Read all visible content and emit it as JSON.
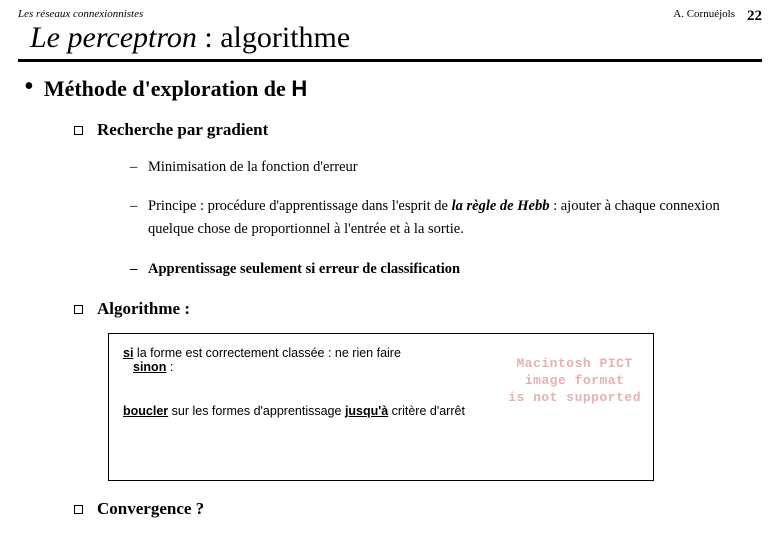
{
  "header": {
    "subtitle": "Les réseaux connexionnistes",
    "author": "A. Cornuéjols",
    "page": "22"
  },
  "title": {
    "part1": "Le perceptron",
    "part2": " : algorithme"
  },
  "lvl1": {
    "prefix": "Méthode d'exploration de ",
    "h": "H"
  },
  "sec1": {
    "label": "Recherche par gradient"
  },
  "b1": "Minimisation de la fonction d'erreur",
  "b2": {
    "pre": "Principe : procédure d'apprentissage dans l'esprit de ",
    "em": "la règle de Hebb",
    "post": " : ajouter à chaque connexion quelque chose de proportionnel à l'entrée et à la sortie."
  },
  "b3": "Apprentissage seulement si erreur de classification",
  "sec2": {
    "label": "Algorithme :"
  },
  "algo": {
    "l1_u": "si",
    "l1_rest": " la forme est correctement classée : ne rien faire",
    "l2": "sinon",
    "l2_colon": " :",
    "l3_u1": "boucler",
    "l3_mid": " sur les formes d'apprentissage ",
    "l3_u2": "jusqu'à",
    "l3_end": " critère d'arrêt"
  },
  "watermark": {
    "l1": "Macintosh PICT",
    "l2": "image format",
    "l3": "is not supported"
  },
  "sec3": {
    "label": "Convergence ?"
  }
}
